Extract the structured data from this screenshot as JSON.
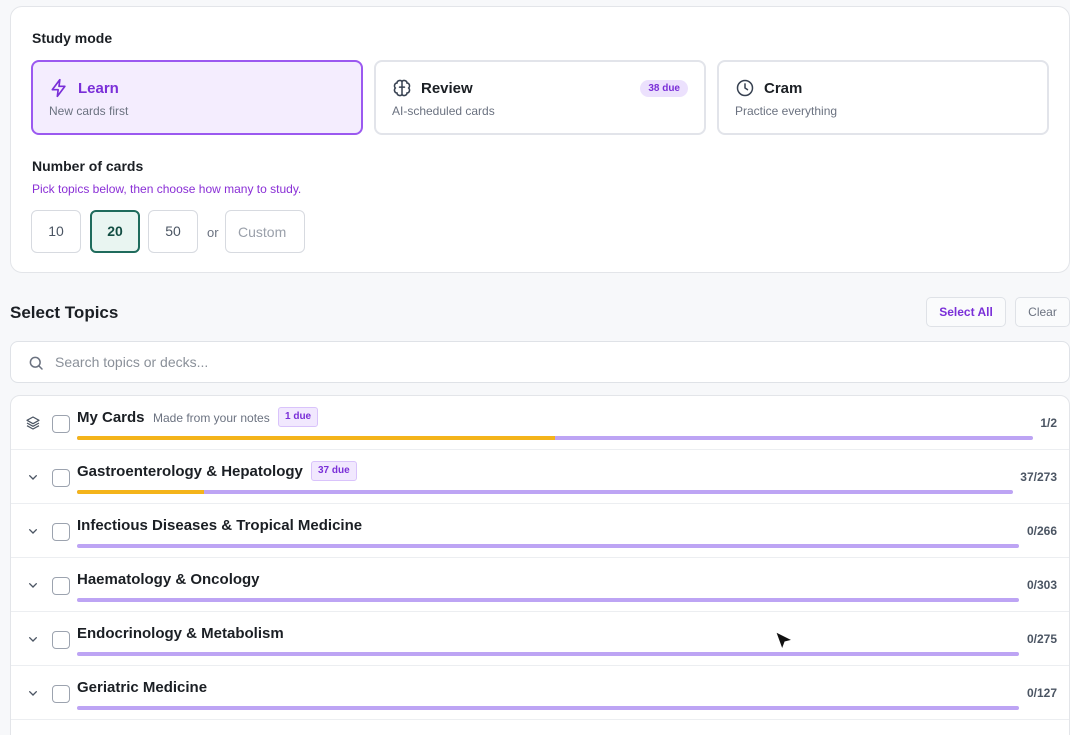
{
  "study": {
    "mode_label": "Study mode",
    "modes": [
      {
        "icon": "bolt-icon",
        "title": "Learn",
        "sub": "New cards first"
      },
      {
        "icon": "brain-icon",
        "title": "Review",
        "sub": "AI-scheduled cards",
        "badge": "38 due"
      },
      {
        "icon": "clock-icon",
        "title": "Cram",
        "sub": "Practice everything"
      }
    ],
    "selected_mode": "Learn",
    "cards_label": "Number of cards",
    "hint": "Pick topics below, then choose how many to study.",
    "counts": [
      "10",
      "20",
      "50"
    ],
    "selected_count": "20",
    "or_label": "or",
    "custom_placeholder": "Custom"
  },
  "topics": {
    "title": "Select Topics",
    "select_all": "Select All",
    "clear": "Clear",
    "search_placeholder": "Search topics or decks...",
    "items": [
      {
        "name": "My Cards",
        "sub": "Made from your notes",
        "badge": "1 due",
        "count": "1/2",
        "progress": 0.5,
        "lead_icon": "layers-icon"
      },
      {
        "name": "Gastroenterology & Hepatology",
        "badge": "37 due",
        "count": "37/273",
        "progress": 0.1355,
        "lead_icon": "chevron-down-icon"
      },
      {
        "name": "Infectious Diseases & Tropical Medicine",
        "count": "0/266",
        "progress": 0,
        "lead_icon": "chevron-down-icon"
      },
      {
        "name": "Haematology & Oncology",
        "count": "0/303",
        "progress": 0,
        "lead_icon": "chevron-down-icon"
      },
      {
        "name": "Endocrinology & Metabolism",
        "count": "0/275",
        "progress": 0,
        "lead_icon": "chevron-down-icon"
      },
      {
        "name": "Geriatric Medicine",
        "count": "0/127",
        "progress": 0,
        "lead_icon": "chevron-down-icon"
      }
    ]
  },
  "colors": {
    "accent": "#7a2fd8",
    "selected_count": "#1f6b5c",
    "progress_done": "#f4b41a",
    "progress_track": "#bda4f4"
  }
}
